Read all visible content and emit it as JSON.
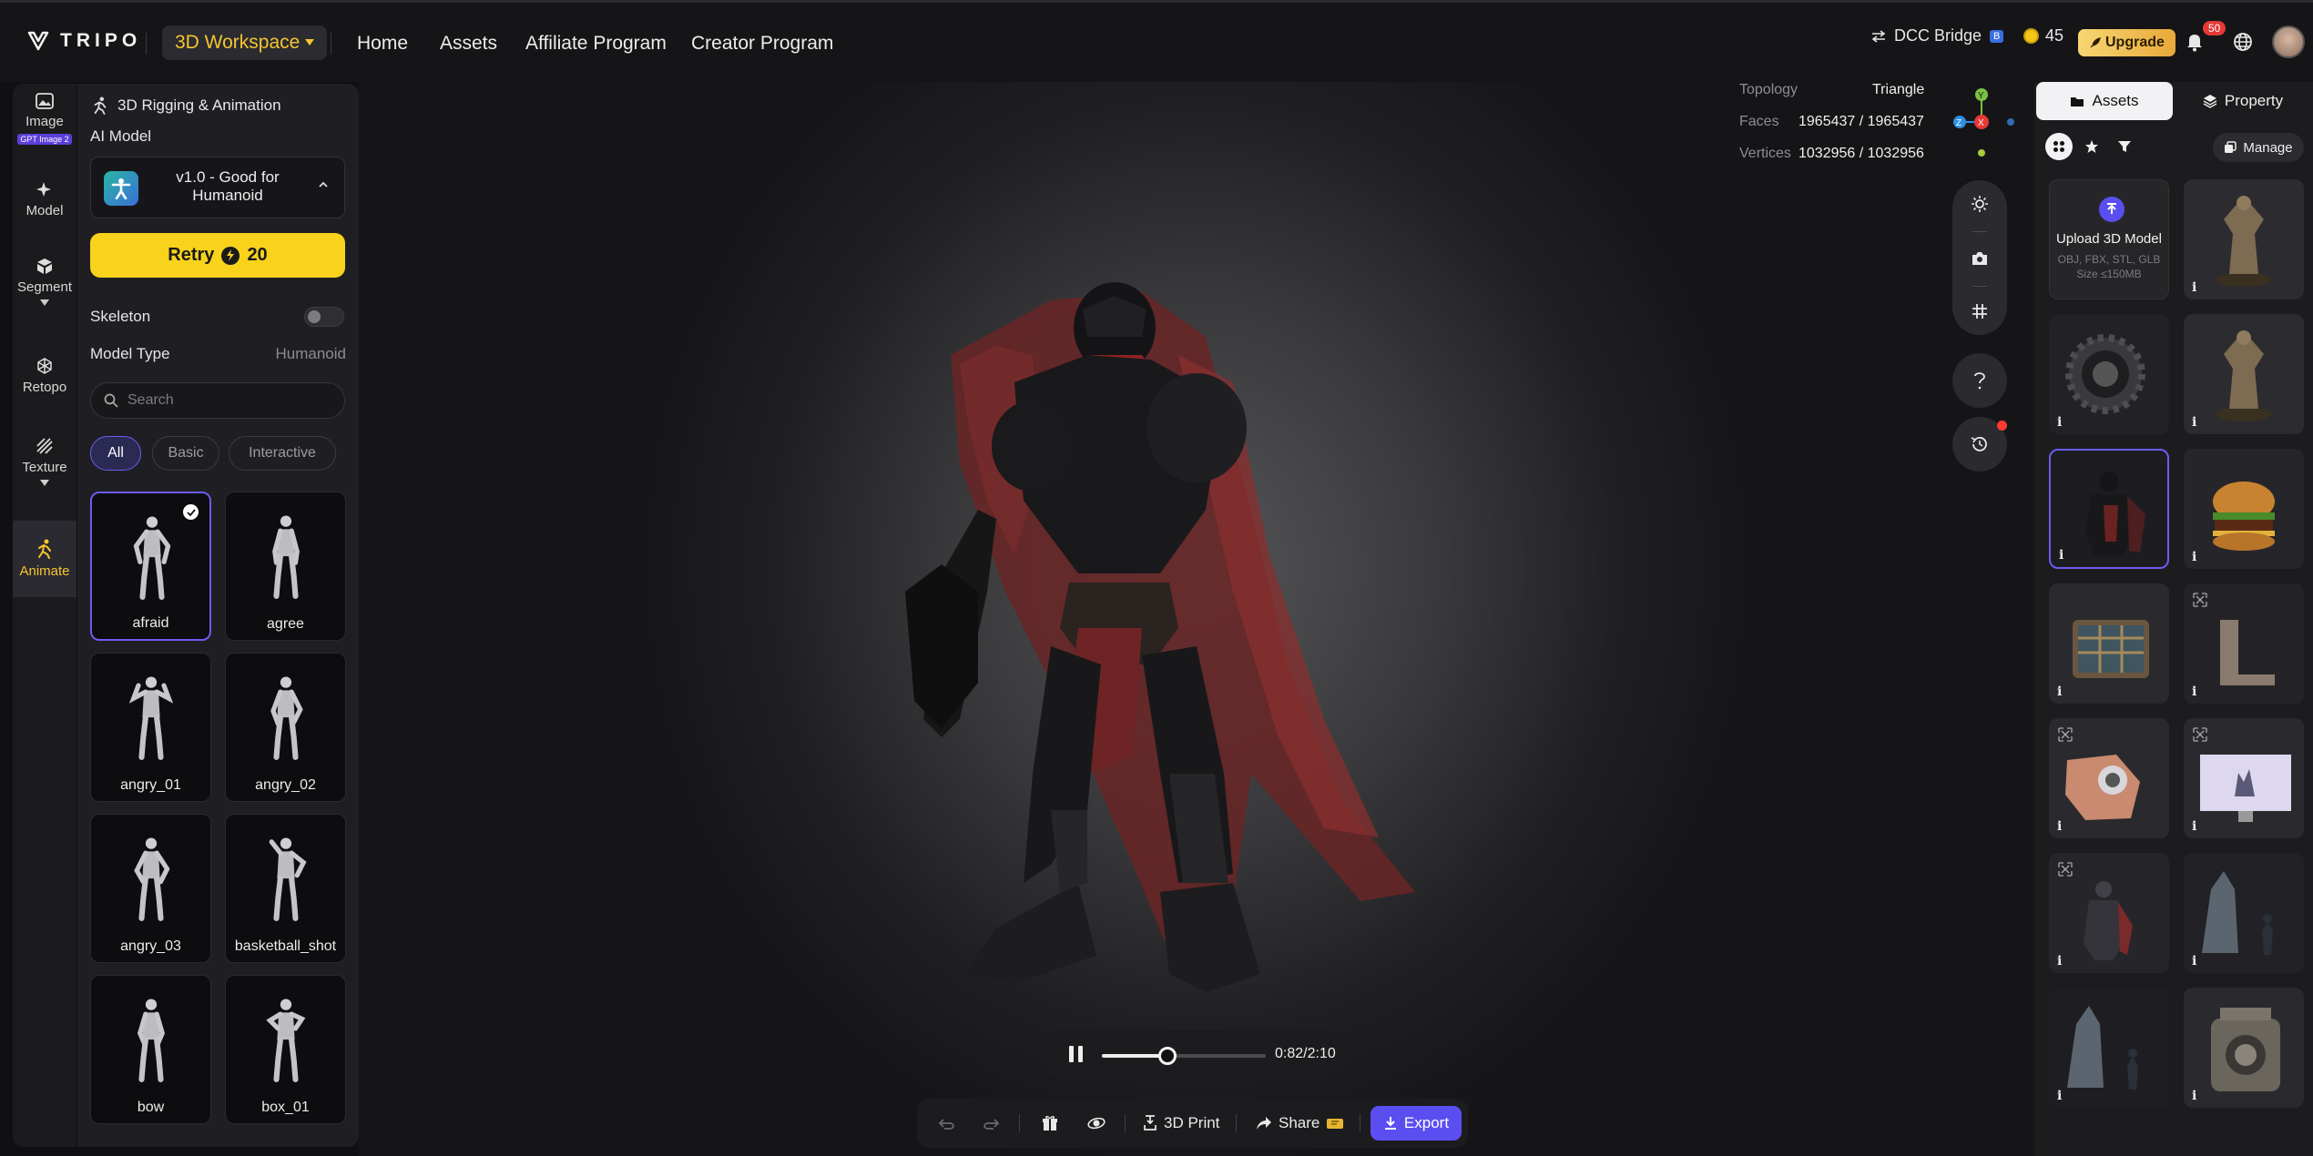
{
  "brand": {
    "name": "TRIPO"
  },
  "topnav": {
    "workspace_label": "3D Workspace",
    "links": [
      "Home",
      "Assets",
      "Affiliate Program",
      "Creator Program"
    ],
    "dcc_label": "DCC Bridge",
    "dcc_badge": "B",
    "credits": "45",
    "upgrade_label": "Upgrade",
    "notification_count": "50"
  },
  "rail": {
    "items": [
      {
        "label": "Image",
        "badge": "GPT Image 2"
      },
      {
        "label": "Model"
      },
      {
        "label": "Segment"
      },
      {
        "label": "Retopo"
      },
      {
        "label": "Texture"
      },
      {
        "label": "Animate"
      }
    ]
  },
  "panel": {
    "title": "3D Rigging & Animation",
    "ai_model_label": "AI Model",
    "model_name": "v1.0 - Good for Humanoid",
    "retry_label": "Retry",
    "retry_cost": "20",
    "skeleton_label": "Skeleton",
    "skeleton_on": false,
    "model_type_label": "Model Type",
    "model_type_value": "Humanoid",
    "search_placeholder": "Search",
    "filters": [
      "All",
      "Basic",
      "Interactive"
    ],
    "active_filter": "All",
    "animations": [
      "afraid",
      "agree",
      "angry_01",
      "angry_02",
      "angry_03",
      "basketball_shot",
      "bow",
      "box_01"
    ],
    "selected_animation": "afraid"
  },
  "viewport": {
    "stats": [
      {
        "label": "Topology",
        "value": "Triangle"
      },
      {
        "label": "Faces",
        "value": "1965437 / 1965437"
      },
      {
        "label": "Vertices",
        "value": "1032956 / 1032956"
      }
    ],
    "gizmo": {
      "x": "X",
      "y": "Y",
      "z": "Z"
    },
    "playback": {
      "current": "0:82",
      "total": "2:10",
      "display": "0:82/2:10",
      "progress": 0.4
    }
  },
  "bottom_toolbar": {
    "print_label": "3D Print",
    "share_label": "Share",
    "export_label": "Export"
  },
  "rpanel": {
    "tabs": [
      "Assets",
      "Property"
    ],
    "active_tab": "Assets",
    "manage_label": "Manage",
    "upload": {
      "title": "Upload 3D Model",
      "formats": "OBJ, FBX, STL, GLB",
      "size": "Size ≤150MB"
    },
    "info_glyph": "i"
  },
  "colors": {
    "accent_yellow": "#f8d21b",
    "accent_purple": "#5b4ef0",
    "background": "#101012",
    "panel": "#1f1f23"
  }
}
